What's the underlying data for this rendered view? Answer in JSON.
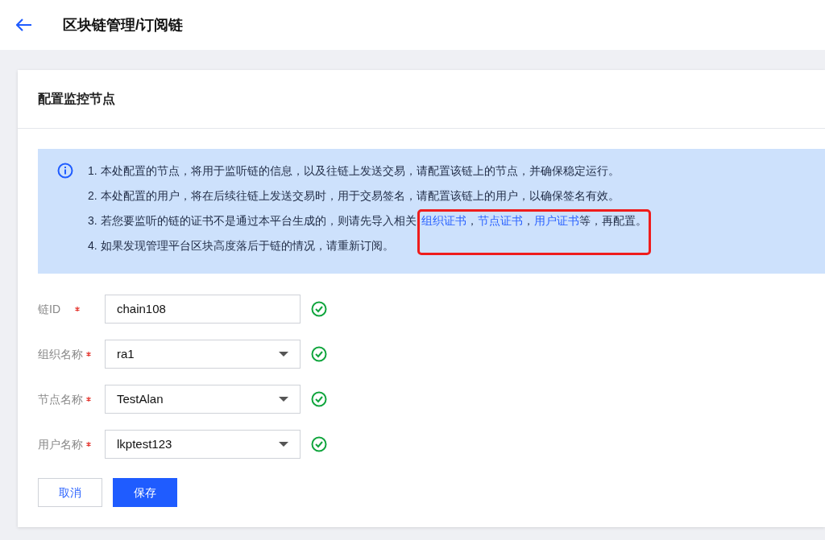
{
  "header": {
    "title": "区块链管理/订阅链"
  },
  "card": {
    "title": "配置监控节点"
  },
  "notice": {
    "lines": [
      [
        {
          "kind": "text",
          "text": "1. 本处配置的节点，将用于监听链的信息，以及往链上发送交易，请配置该链上的节点，并确保稳定运行。"
        }
      ],
      [
        {
          "kind": "text",
          "text": "2. 本处配置的用户，将在后续往链上发送交易时，用于交易签名，请配置该链上的用户，以确保签名有效。"
        }
      ],
      [
        {
          "kind": "text",
          "text": "3. 若您要监听的链的证书不是通过本平台生成的，则请先导入相关"
        },
        {
          "kind": "link",
          "text": "组织证书"
        },
        {
          "kind": "text",
          "text": "，"
        },
        {
          "kind": "link",
          "text": "节点证书"
        },
        {
          "kind": "text",
          "text": "，"
        },
        {
          "kind": "link",
          "text": "用户证书"
        },
        {
          "kind": "text",
          "text": "等，再配置。"
        }
      ],
      [
        {
          "kind": "text",
          "text": "4. 如果发现管理平台区块高度落后于链的情况，请重新订阅。"
        }
      ]
    ]
  },
  "fields": [
    {
      "label": "链ID",
      "required": true,
      "kind": "input",
      "value": "chain108",
      "valid": true
    },
    {
      "label": "组织名称",
      "required": true,
      "kind": "select",
      "value": "ra1",
      "valid": true
    },
    {
      "label": "节点名称",
      "required": true,
      "kind": "select",
      "value": "TestAlan",
      "valid": true
    },
    {
      "label": "用户名称",
      "required": true,
      "kind": "select",
      "value": "lkptest123",
      "valid": true
    }
  ],
  "buttons": [
    {
      "label": "取消",
      "kind": "secondary"
    },
    {
      "label": "保存",
      "kind": "primary"
    }
  ]
}
